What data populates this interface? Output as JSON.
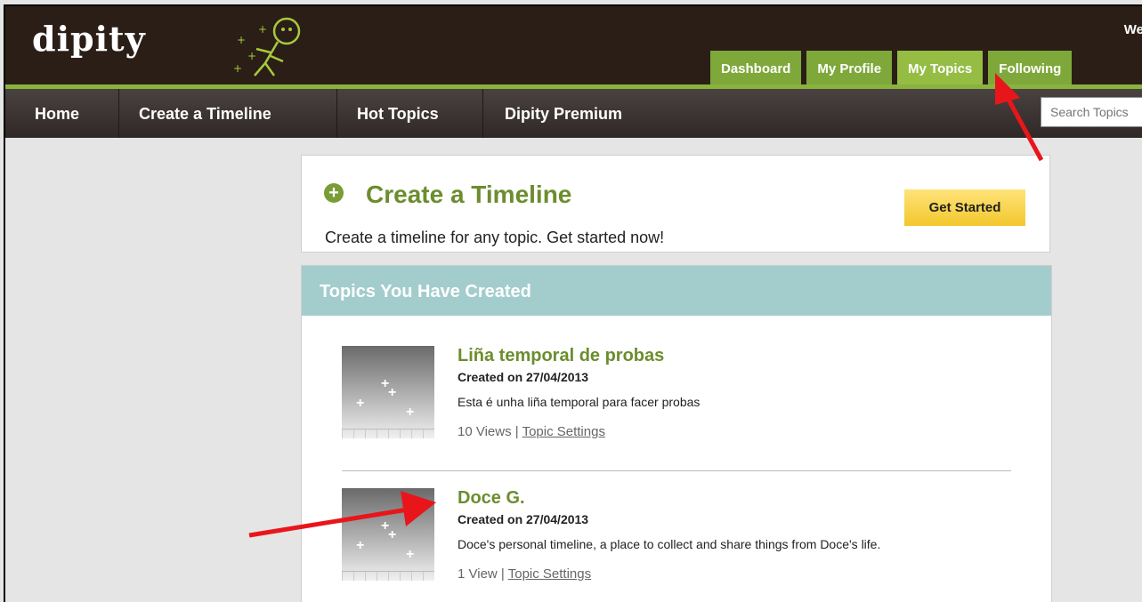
{
  "header": {
    "logo_text": "dipity",
    "welcome_text": "We",
    "tabs": [
      {
        "label": "Dashboard"
      },
      {
        "label": "My Profile"
      },
      {
        "label": "My Topics"
      },
      {
        "label": "Following"
      }
    ]
  },
  "nav": {
    "items": [
      {
        "label": "Home"
      },
      {
        "label": "Create a Timeline"
      },
      {
        "label": "Hot Topics"
      },
      {
        "label": "Dipity Premium"
      }
    ],
    "search_placeholder": "Search Topics"
  },
  "create": {
    "title": "Create a Timeline",
    "description": "Create a timeline for any topic. Get started now!",
    "button_label": "Get Started"
  },
  "topics": {
    "header": "Topics You Have Created",
    "items": [
      {
        "title": "Liña temporal de probas",
        "created": "Created on 27/04/2013",
        "description": "Esta é unha liña temporal para facer probas",
        "views": "10 Views",
        "settings_label": "Topic Settings"
      },
      {
        "title": "Doce G.",
        "created": "Created on 27/04/2013",
        "description": "Doce's personal timeline, a place to collect and share things from Doce's life.",
        "views": "1 View",
        "settings_label": "Topic Settings"
      }
    ]
  },
  "colors": {
    "topbar": "#2a1e17",
    "tab_green": "#7fa83a",
    "accent_green": "#6c8d2e",
    "topics_header": "#a3cccd",
    "button_yellow": "#f2c72c",
    "annotation_arrow": "#e8161b"
  }
}
